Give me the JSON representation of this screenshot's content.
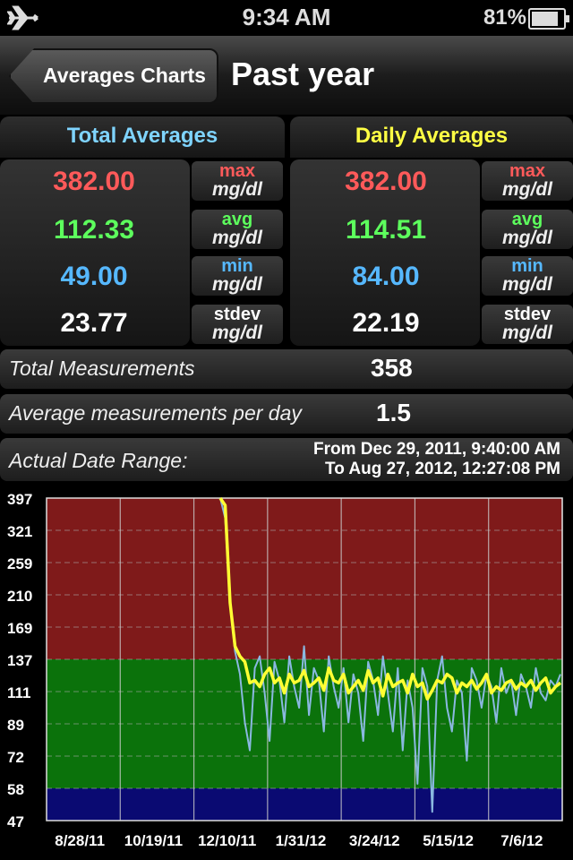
{
  "status_bar": {
    "time": "9:34 AM",
    "battery": "81%"
  },
  "nav": {
    "back_label": "Averages Charts",
    "title": "Past year"
  },
  "total": {
    "header": "Total Averages",
    "max": "382.00",
    "avg": "112.33",
    "min": "49.00",
    "stdev": "23.77"
  },
  "daily": {
    "header": "Daily Averages",
    "max": "382.00",
    "avg": "114.51",
    "min": "84.00",
    "stdev": "22.19"
  },
  "labels": {
    "max": "max",
    "avg": "avg",
    "min": "min",
    "stdev": "stdev",
    "unit": "mg/dl"
  },
  "summary": {
    "total_measurements_label": "Total Measurements",
    "total_measurements": "358",
    "avg_per_day_label": "Average measurements per day",
    "avg_per_day": "1.5",
    "date_range_label": "Actual Date Range:",
    "date_from": "From Dec 29, 2011, 9:40:00 AM",
    "date_to": "To Aug 27, 2012, 12:27:08 PM"
  },
  "colors": {
    "high_zone": "#7f1a1a",
    "normal_zone": "#0b720b",
    "low_zone": "#0a0a72",
    "daily_line": "#ffff33",
    "raw_line": "#8ab8e0",
    "max_color": "#ff5a5a",
    "avg_color": "#5dff5d",
    "min_color": "#56b8ff"
  },
  "chart_data": {
    "type": "line",
    "y_ticks": [
      "397",
      "321",
      "259",
      "210",
      "169",
      "137",
      "111",
      "89",
      "72",
      "58",
      "47"
    ],
    "x_ticks": [
      "8/28/11",
      "10/19/11",
      "12/10/11",
      "1/31/12",
      "3/24/12",
      "5/15/12",
      "7/6/12"
    ],
    "zones": {
      "high_min": 137,
      "low_max": 58
    },
    "series": [
      {
        "values": [
          397,
          380,
          200,
          150,
          140,
          135,
          118,
          120,
          115,
          125,
          130,
          118,
          122,
          110,
          125,
          118,
          120,
          128,
          115,
          118,
          122,
          112,
          130,
          120,
          118,
          125,
          110,
          115,
          120,
          112,
          128,
          118,
          122,
          108,
          125,
          115,
          118,
          120,
          110,
          125,
          115,
          118,
          106,
          112,
          120,
          118,
          125,
          122,
          110,
          118,
          115,
          120,
          113,
          118,
          125,
          110,
          115,
          112,
          118,
          120,
          113,
          118,
          115,
          120,
          112,
          118,
          122,
          110,
          115,
          118
        ]
      },
      {
        "values": [
          397,
          350,
          200,
          145,
          125,
          90,
          75,
          130,
          140,
          110,
          80,
          135,
          120,
          90,
          140,
          115,
          100,
          150,
          95,
          130,
          120,
          85,
          140,
          115,
          100,
          130,
          90,
          125,
          110,
          80,
          135,
          120,
          95,
          140,
          110,
          85,
          130,
          75,
          120,
          100,
          60,
          130,
          115,
          50,
          120,
          140,
          100,
          85,
          120,
          110,
          70,
          130,
          120,
          100,
          125,
          115,
          90,
          130,
          110,
          120,
          95,
          125,
          115,
          100,
          130,
          110,
          105,
          120,
          115,
          125
        ]
      }
    ]
  }
}
